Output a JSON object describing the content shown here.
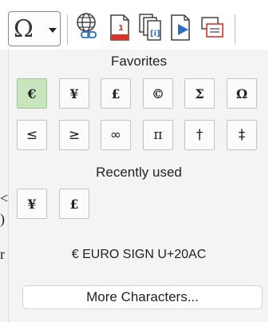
{
  "toolbar": {
    "special_button_glyph": "Ω",
    "icons": [
      "special-character-icon",
      "dropdown-arrow-icon",
      "hyperlink-icon",
      "footnote-icon",
      "copy-pages-icon",
      "play-slide-icon",
      "insert-frame-icon"
    ]
  },
  "popup": {
    "favorites_title": "Favorites",
    "favorites": [
      "€",
      "¥",
      "£",
      "©",
      "Σ",
      "Ω",
      "≤",
      "≥",
      "∞",
      "π",
      "†",
      "‡"
    ],
    "recent_title": "Recently used",
    "recent": [
      "¥",
      "£"
    ],
    "selected_char_info": "€ EURO SIGN U+20AC",
    "more_button": "More Characters..."
  },
  "colors": {
    "selected_cell": "#c7e6bd",
    "popup_bg": "#f4f4f4",
    "icon_red": "#d9342b",
    "icon_blue": "#2a6fc9"
  }
}
